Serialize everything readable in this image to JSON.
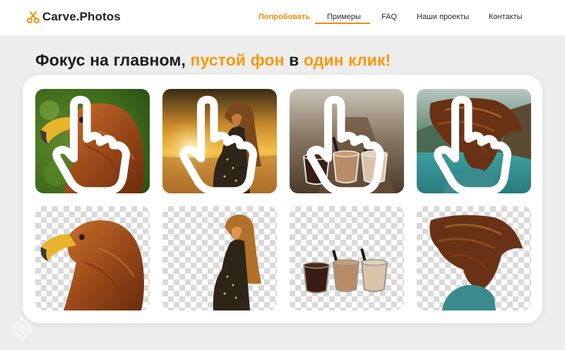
{
  "header": {
    "logo_text": "Carve.Photos",
    "nav": [
      {
        "label": "Попробовать",
        "active": true
      },
      {
        "label": "Примеры",
        "active": false
      },
      {
        "label": "FAQ",
        "active": false
      },
      {
        "label": "Наши проекты",
        "active": false
      },
      {
        "label": "Контакты",
        "active": false
      }
    ]
  },
  "headline": {
    "part1": "Фокус на главном, ",
    "part2": "пустой фон",
    "part3": " в ",
    "part4": "один клик!"
  },
  "colors": {
    "accent": "#f59a0c",
    "background": "#ededed",
    "card": "#ffffff"
  },
  "examples": [
    {
      "subject": "eagle",
      "original_icon": "tap-hand-icon"
    },
    {
      "subject": "woman-at-sunset",
      "original_icon": "tap-hand-icon"
    },
    {
      "subject": "coffee-cups",
      "original_icon": "tap-hand-icon"
    },
    {
      "subject": "woman-hair-wind",
      "original_icon": "tap-hand-icon"
    }
  ]
}
